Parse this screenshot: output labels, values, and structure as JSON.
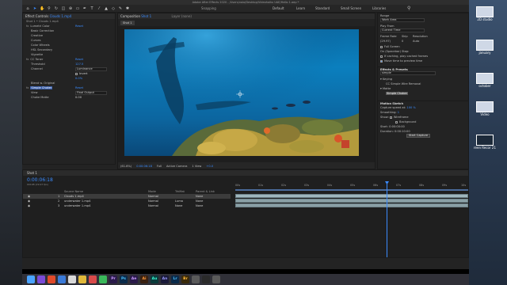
{
  "window": {
    "title": "Adobe After Effects 2020 - /Users/vaio/Desktop/Videohaiku UAE/Hello 1.aep *"
  },
  "toolbar": {
    "snapping": "Snapping",
    "workspaces": [
      "Default",
      "Learn",
      "Standard",
      "Small Screen",
      "Libraries"
    ]
  },
  "effect_controls": {
    "tab": "Effect Controls",
    "tab_layer": "Clouds 1.mp4",
    "comp_prefix": "Shot 1 • Clouds 1.mp4",
    "rows": [
      {
        "name": "Lumetri Color",
        "value": "Reset"
      },
      {
        "name": "Basic Correction",
        "value": ""
      },
      {
        "name": "Creative",
        "value": ""
      },
      {
        "name": "Curves",
        "value": ""
      },
      {
        "name": "Color Wheels",
        "value": ""
      },
      {
        "name": "HSL Secondary",
        "value": ""
      },
      {
        "name": "Vignette",
        "value": ""
      },
      {
        "name": "CC Toner",
        "value": "Reset"
      },
      {
        "name": "Threshold",
        "value": "127.5"
      },
      {
        "name": "Channel",
        "value": "Luminance"
      },
      {
        "name": "",
        "value": "Invert"
      },
      {
        "name": "",
        "value": "0.0%"
      },
      {
        "name": "Blend w. Original",
        "value": ""
      },
      {
        "name": "Simple Choker",
        "value": "Reset"
      },
      {
        "name": "View",
        "value": "Final Output"
      },
      {
        "name": "Choke Matte",
        "value": "0.00"
      }
    ]
  },
  "composition": {
    "tab": "Composition",
    "tab_name": "Shot 1",
    "layer_tab": "Layer (none)",
    "breadcrumb": "Shot 1",
    "zoom": "(61.6%)",
    "time": "0:00:06:18",
    "resolution": "Full",
    "camera": "Active Camera",
    "views": "1 View",
    "exposure": "+0.0"
  },
  "preview": {
    "range_label": "Range",
    "range_value": "Work Area",
    "play_from_label": "Play From",
    "play_from_value": "Current Time",
    "frame_rate_label": "Frame Rate",
    "skip_label": "Skip",
    "resolution_label": "Resolution",
    "frame_rate_value": "(29.97)",
    "skip_value": "0",
    "resolution_value": "Auto",
    "full_screen": "Full Screen",
    "on_stop_label": "On (Spacebar) Stop:",
    "if_caching": "If caching, play cached frames",
    "move_time": "Move time to preview time"
  },
  "effects_presets": {
    "header": "Effects & Presets",
    "search": "simple",
    "keying": "Keying",
    "keying_item": "CC Simple Wire Removal",
    "matte": "Matte",
    "matte_item": "Simple Choker"
  },
  "motion_sketch": {
    "header": "Motion Sketch",
    "capture_label": "Capture speed at:",
    "capture_value": "100 %",
    "smoothing_label": "Smoothing:",
    "smoothing_value": "1",
    "show_label": "Show:",
    "wireframe": "Wireframe",
    "background": "Background",
    "start_label": "Start:",
    "start_value": "0:00:00:00",
    "duration_label": "Duration:",
    "duration_value": "0:00:10:00",
    "capture_button": "Start Capture"
  },
  "timeline": {
    "tab": "Shot 1",
    "timecode": "0:00:06:18",
    "fps": "00198 (29.97 fps)",
    "columns": [
      "Source Name",
      "Mode",
      "TrkMat",
      "Parent & Link"
    ],
    "layers": [
      {
        "num": "1",
        "name": "Clouds 1.mp4",
        "mode": "Normal",
        "trkmat": "",
        "parent": "None"
      },
      {
        "num": "2",
        "name": "underwater 1.mp4",
        "mode": "Normal",
        "trkmat": "Luma",
        "parent": "None"
      },
      {
        "num": "3",
        "name": "underwater 1.mp4",
        "mode": "Normal",
        "trkmat": "None",
        "parent": "None"
      }
    ],
    "ruler_labels": [
      "00s",
      "01s",
      "02s",
      "03s",
      "04s",
      "05s",
      "06s",
      "07s",
      "08s",
      "09s",
      "10s"
    ]
  },
  "desktop": {
    "icons": [
      "2D studio",
      "january",
      "october",
      "Video",
      "reen Recor 21-01...PM"
    ]
  },
  "dock": {
    "apps": [
      "Pr",
      "Ps",
      "Ae",
      "Ai",
      "Au",
      "An",
      "Lr",
      "Br"
    ]
  },
  "colors": {
    "accent": "#3b8cff",
    "panel": "#232323",
    "track": "#8aa0a6"
  }
}
